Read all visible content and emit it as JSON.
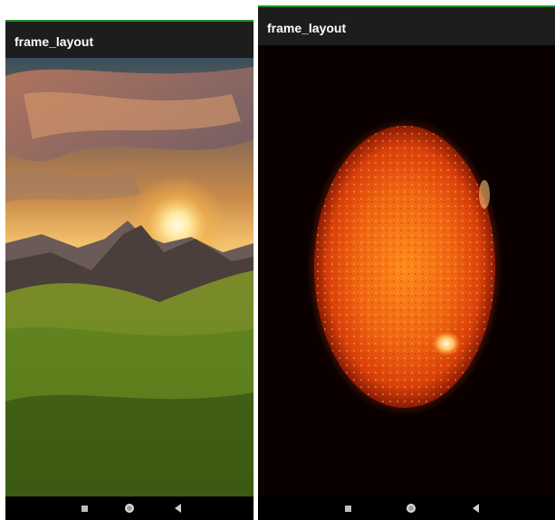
{
  "screens": [
    {
      "app_bar": {
        "title": "frame_layout"
      },
      "image": {
        "icon": "mountain-sunrise-image"
      },
      "nav": {
        "recents": "square-icon",
        "home": "circle-icon",
        "back": "triangle-icon"
      }
    },
    {
      "app_bar": {
        "title": "frame_layout"
      },
      "image": {
        "icon": "sun-image"
      },
      "nav": {
        "recents": "square-icon",
        "home": "circle-icon",
        "back": "triangle-icon"
      }
    }
  ],
  "colors": {
    "app_bar_bg": "#1d1d1d",
    "status_accent": "#1f8f2a",
    "nav_bar_bg": "#000000"
  }
}
